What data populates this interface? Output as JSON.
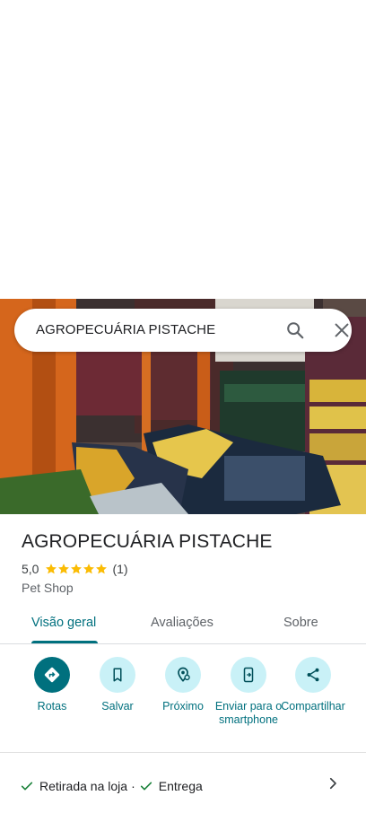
{
  "search": {
    "query": "AGROPECUÁRIA PISTACHE"
  },
  "place": {
    "title": "AGROPECUÁRIA PISTACHE",
    "rating": "5,0",
    "stars": 5,
    "review_count": "(1)",
    "category": "Pet Shop"
  },
  "tabs": [
    {
      "label": "Visão geral",
      "active": true
    },
    {
      "label": "Avaliações",
      "active": false
    },
    {
      "label": "Sobre",
      "active": false
    }
  ],
  "actions": [
    {
      "label": "Rotas",
      "icon": "directions-icon"
    },
    {
      "label": "Salvar",
      "icon": "bookmark-icon"
    },
    {
      "label": "Próximo",
      "icon": "nearby-icon"
    },
    {
      "label": "Enviar para o smartphone",
      "icon": "send-to-phone-icon"
    },
    {
      "label": "Compartilhar",
      "icon": "share-icon"
    }
  ],
  "services": {
    "item1": "Retirada na loja",
    "separator": "·",
    "item2": "Entrega"
  },
  "colors": {
    "accent": "#00707e",
    "action_bg": "#c9f1f7",
    "star": "#fbbc04",
    "check": "#188038"
  }
}
